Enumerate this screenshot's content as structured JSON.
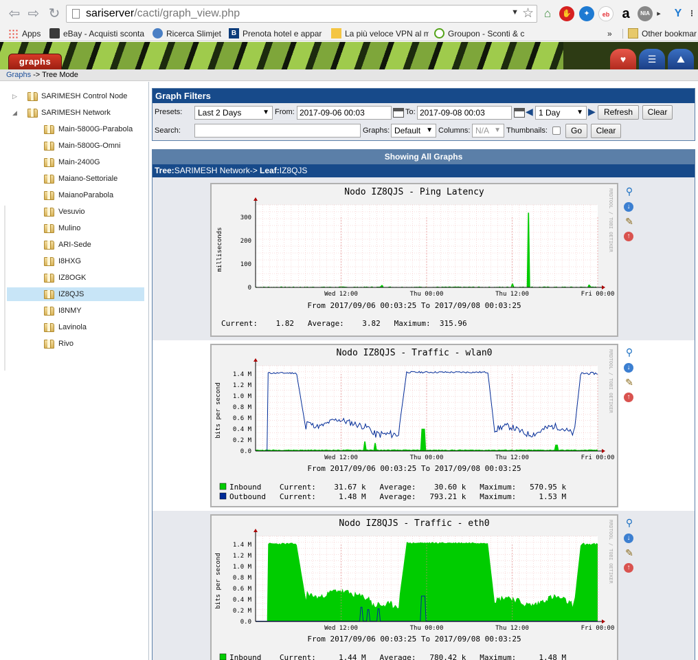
{
  "browser": {
    "url_host": "sariserver",
    "url_path": "/cacti/graph_view.php",
    "bookmarks": [
      {
        "label": "Apps"
      },
      {
        "label": "eBay - Acquisti sconta"
      },
      {
        "label": "Ricerca Slimjet"
      },
      {
        "label": "Prenota hotel e appar"
      },
      {
        "label": "La più veloce VPN al m"
      },
      {
        "label": "Groupon - Sconti & c"
      }
    ],
    "bookmarks_more": "»",
    "other_bookmarks": "Other bookmar"
  },
  "header": {
    "tab_label": "graphs",
    "breadcrumb_link": "Graphs",
    "breadcrumb_rest": " -> Tree Mode"
  },
  "tree": {
    "roots": [
      {
        "label": "SARIMESH Control Node",
        "expanded": false
      },
      {
        "label": "SARIMESH Network",
        "expanded": true
      }
    ],
    "leaves": [
      "Main-5800G-Parabola",
      "Main-5800G-Omni",
      "Main-2400G",
      "Maiano-Settoriale",
      "MaianoParabola",
      "Vesuvio",
      "Mulino",
      "ARI-Sede",
      "I8HXG",
      "IZ8OGK",
      "IZ8QJS",
      "I8NMY",
      "Lavinola",
      "Rivo"
    ],
    "selected": "IZ8QJS"
  },
  "filters": {
    "title": "Graph Filters",
    "presets_label": "Presets:",
    "presets_value": "Last 2 Days",
    "from_label": "From:",
    "from_value": "2017-09-06 00:03",
    "to_label": "To:",
    "to_value": "2017-09-08 00:03",
    "span_value": "1 Day",
    "refresh_label": "Refresh",
    "clear_label": "Clear",
    "search_label": "Search:",
    "search_value": "",
    "graphs_label": "Graphs:",
    "graphs_value": "Default",
    "columns_label": "Columns:",
    "columns_value": "N/A",
    "thumbnails_label": "Thumbnails:",
    "go_label": "Go",
    "clear2_label": "Clear"
  },
  "graphs_panel": {
    "showing": "Showing All Graphs",
    "tree_prefix": "Tree:",
    "tree_name": "SARIMESH Network->",
    "leaf_prefix": " Leaf:",
    "leaf_name": "IZ8QJS"
  },
  "graphs": [
    {
      "title": "Nodo IZ8QJS - Ping Latency",
      "ylabel": "milliseconds",
      "yticks": [
        "300",
        "200",
        "100",
        "0"
      ],
      "xticks": [
        "Wed 12:00",
        "Thu 00:00",
        "Thu 12:00",
        "Fri 00:00"
      ],
      "range_text": "From 2017/09/06 00:03:25 To 2017/09/08 00:03:25",
      "stats": [
        "Current:    1.82   Average:    3.82   Maximum:  315.96"
      ],
      "side_text": "RRDTOOL / TOBI OETIKER"
    },
    {
      "title": "Nodo IZ8QJS - Traffic - wlan0",
      "ylabel": "bits per second",
      "yticks": [
        "1.4 M",
        "1.2 M",
        "1.0 M",
        "0.8 M",
        "0.6 M",
        "0.4 M",
        "0.2 M",
        "0.0"
      ],
      "xticks": [
        "Wed 12:00",
        "Thu 00:00",
        "Thu 12:00",
        "Fri 00:00"
      ],
      "range_text": "From 2017/09/06 00:03:25 To 2017/09/08 00:03:25",
      "stats": [
        "Inbound    Current:    31.67 k   Average:    30.60 k   Maximum:   570.95 k",
        "Outbound   Current:     1.48 M   Average:   793.21 k   Maximum:     1.53 M"
      ],
      "side_text": "RRDTOOL / TOBI OETIKER"
    },
    {
      "title": "Nodo IZ8QJS - Traffic - eth0",
      "ylabel": "bits per second",
      "yticks": [
        "1.4 M",
        "1.2 M",
        "1.0 M",
        "0.8 M",
        "0.6 M",
        "0.4 M",
        "0.2 M",
        "0.0"
      ],
      "xticks": [
        "Wed 12:00",
        "Thu 00:00",
        "Thu 12:00",
        "Fri 00:00"
      ],
      "range_text": "From 2017/09/06 00:03:25 To 2017/09/08 00:03:25",
      "stats": [
        "Inbound    Current:     1.44 M   Average:   780.42 k   Maximum:     1.48 M"
      ],
      "side_text": "RRDTOOL / TOBI OETIKER"
    }
  ],
  "colors": {
    "inbound": "#00cc00",
    "outbound": "#002a97",
    "header_blue": "#174a8a",
    "selected_row": "#c8e5f7"
  }
}
